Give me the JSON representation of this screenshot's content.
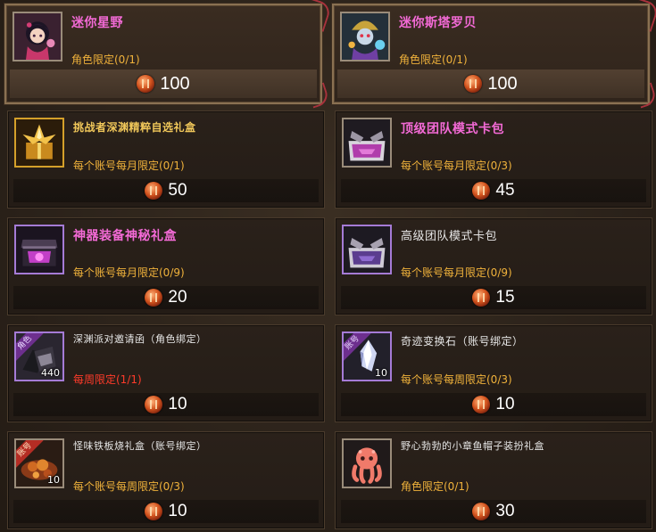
{
  "currency_icon": "blood-coin-icon",
  "colors": {
    "name_pink": "#f36ad6",
    "name_gold": "#f0c75a",
    "limit_orange": "#f0b23b",
    "limit_red": "#ff3b2a",
    "frame_gold": "#d4a02a",
    "frame_purple": "#a57bd6"
  },
  "items": [
    {
      "name": "迷你星野",
      "limit": "角色限定(0/1)",
      "price": "100",
      "icon": "chibi-girl-icon"
    },
    {
      "name": "迷你斯塔罗贝",
      "limit": "角色限定(0/1)",
      "price": "100",
      "icon": "chibi-clown-icon"
    },
    {
      "name": "挑战者深渊精粹自选礼盒",
      "limit": "每个账号每月限定(0/1)",
      "price": "50",
      "icon": "golden-gift-box-icon"
    },
    {
      "name": "顶级团队模式卡包",
      "limit": "每个账号每月限定(0/3)",
      "price": "45",
      "icon": "card-pack-icon"
    },
    {
      "name": "神器装备神秘礼盒",
      "limit": "每个账号每月限定(0/9)",
      "price": "20",
      "icon": "mystery-chest-icon"
    },
    {
      "name": "高级团队模式卡包",
      "limit": "每个账号每月限定(0/9)",
      "price": "15",
      "icon": "card-pack-icon"
    },
    {
      "name": "深渊派对邀请函（角色绑定）",
      "limit": "每周限定(1/1)",
      "price": "10",
      "icon": "invitation-icon",
      "tag": "角色",
      "qty": "440"
    },
    {
      "name": "奇迹变换石（账号绑定）",
      "limit": "每个账号每周限定(0/3)",
      "price": "10",
      "icon": "crystal-icon",
      "tag": "账号",
      "qty": "10"
    },
    {
      "name": "怪味铁板烧礼盒（账号绑定）",
      "limit": "每个账号每周限定(0/3)",
      "price": "10",
      "icon": "food-box-icon",
      "tag": "账号",
      "qty": "10"
    },
    {
      "name": "野心勃勃的小章鱼帽子装扮礼盒",
      "limit": "角色限定(0/1)",
      "price": "30",
      "icon": "octopus-hat-icon"
    }
  ]
}
